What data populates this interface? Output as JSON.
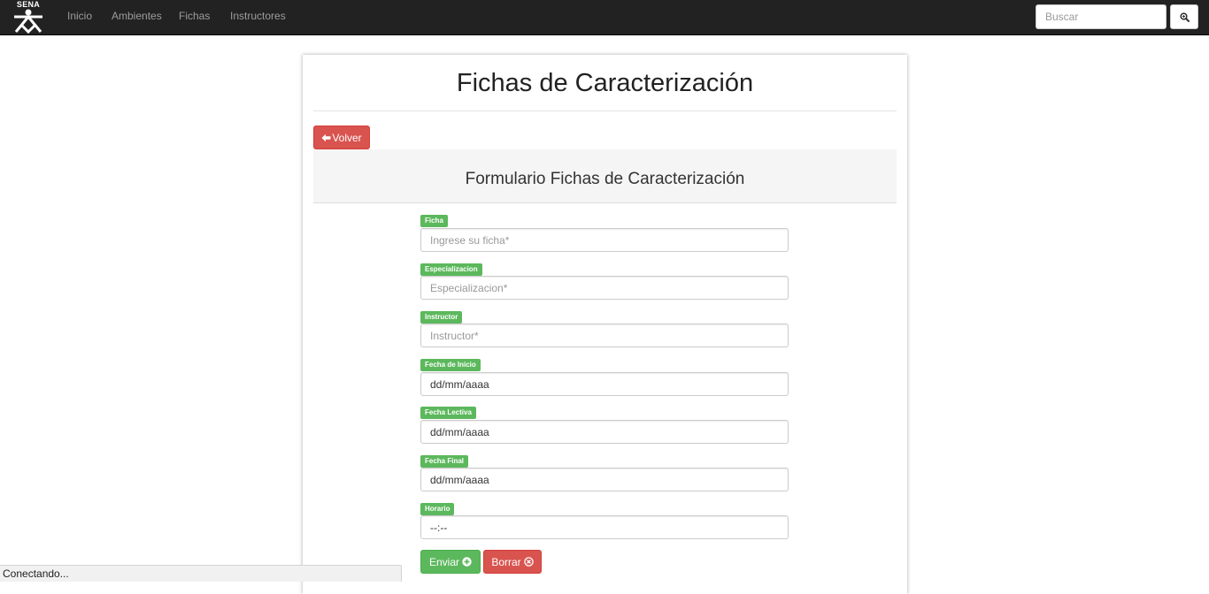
{
  "navbar": {
    "brand": "SENA",
    "links": [
      "Inicio",
      "Ambientes",
      "Fichas",
      "Instructores"
    ],
    "search_placeholder": "Buscar",
    "search_icon": "search-icon"
  },
  "page": {
    "title": "Fichas de Caracterización",
    "back_label": "Volver",
    "back_icon": "arrow-left-icon",
    "form_title": "Formulario Fichas de Caracterización"
  },
  "form": {
    "fields": [
      {
        "label": "Ficha",
        "placeholder": "Ingrese su ficha*",
        "value": ""
      },
      {
        "label": "Especializacion",
        "placeholder": "Especializacion*",
        "value": ""
      },
      {
        "label": "Instructor",
        "placeholder": "Instructor*",
        "value": ""
      },
      {
        "label": "Fecha de Inicio",
        "placeholder": "",
        "value": "dd/mm/aaaa"
      },
      {
        "label": "Fecha Lectiva",
        "placeholder": "",
        "value": "dd/mm/aaaa"
      },
      {
        "label": "Fecha Final",
        "placeholder": "",
        "value": "dd/mm/aaaa"
      },
      {
        "label": "Horario",
        "placeholder": "",
        "value": "--:--"
      }
    ],
    "submit_label": "Enviar",
    "submit_icon": "plus-circle-icon",
    "clear_label": "Borrar",
    "clear_icon": "remove-circle-icon"
  },
  "status_bar": {
    "text": "Conectando..."
  },
  "colors": {
    "navbar_bg": "#222222",
    "nav_link": "#9d9d9d",
    "danger": "#d9534f",
    "success": "#5cb85c",
    "form_header_bg": "#f5f5f5"
  }
}
